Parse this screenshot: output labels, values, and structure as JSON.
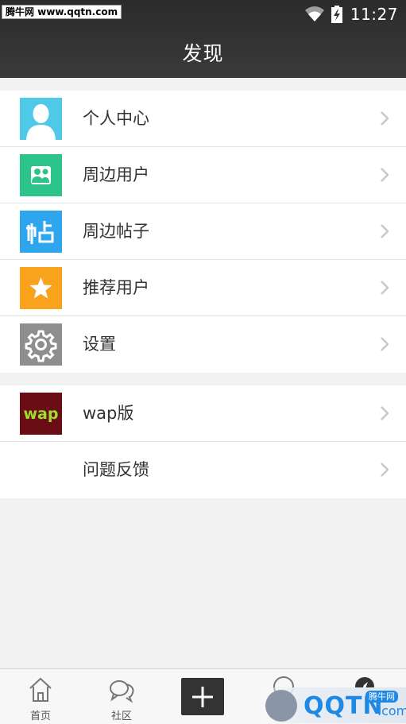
{
  "status_bar": {
    "watermark": "腾牛网 www.qqtn.com",
    "time": "11:27",
    "icons": [
      "notification-icon",
      "wifi-icon",
      "battery-icon"
    ]
  },
  "header": {
    "title": "发现"
  },
  "groups": [
    {
      "items": [
        {
          "label": "个人中心",
          "icon": "person-icon",
          "color": "#4fc9e8"
        },
        {
          "label": "周边用户",
          "icon": "users-icon",
          "color": "#2dc48b"
        },
        {
          "label": "周边帖子",
          "icon": "post-icon",
          "color": "#2ea6ee"
        },
        {
          "label": "推荐用户",
          "icon": "star-icon",
          "color": "#f9a21b"
        },
        {
          "label": "设置",
          "icon": "gear-icon",
          "color": "#8e8e8e"
        }
      ]
    },
    {
      "items": [
        {
          "label": "wap版",
          "icon": "wap-icon",
          "icon_text": "wap",
          "color": "#6b0d14"
        },
        {
          "label": "问题反馈",
          "icon": "none"
        }
      ]
    }
  ],
  "tabbar": {
    "tabs": [
      {
        "label": "首页",
        "icon": "home-icon"
      },
      {
        "label": "社区",
        "icon": "chat-icon"
      },
      {
        "label": "",
        "icon": "add-icon"
      }
    ]
  },
  "overlay_logo": {
    "text": "QQTN",
    "suffix": ".com",
    "badge": "腾牛网"
  },
  "colors": {
    "header_bg": "#333333",
    "page_bg": "#f2f2f2",
    "chevron": "#c8c8c8"
  }
}
